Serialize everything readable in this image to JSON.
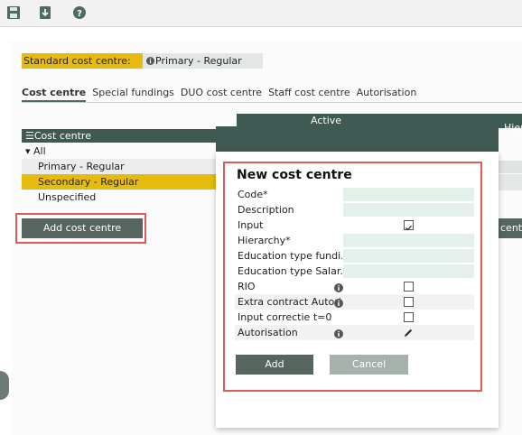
{
  "toolbar": {
    "icons": [
      "save-icon",
      "download-icon",
      "help-icon"
    ]
  },
  "standard": {
    "label": "Standard cost centre:",
    "value": "Primary - Regular"
  },
  "tabs": [
    {
      "label": "Cost centre",
      "active": true
    },
    {
      "label": "Special fundings",
      "active": false
    },
    {
      "label": "DUO cost centre",
      "active": false
    },
    {
      "label": "Staff cost centre",
      "active": false
    },
    {
      "label": "Autorisation",
      "active": false
    }
  ],
  "background_table": {
    "active_header": "Active",
    "hier_header": "Hier"
  },
  "tree": {
    "header": "Cost centre",
    "items": [
      {
        "label": "All"
      },
      {
        "label": "Primary - Regular"
      },
      {
        "label": "Secondary - Regular"
      },
      {
        "label": "Unspecified"
      }
    ]
  },
  "add_cost_centre_button": "Add cost centre",
  "right_button_fragment": "cent",
  "modal": {
    "title": "New cost centre",
    "fields": [
      {
        "label": "Code*"
      },
      {
        "label": "Description"
      },
      {
        "label": "Input",
        "checked": true
      },
      {
        "label": "Hierarchy*"
      },
      {
        "label": "Education type fundi..."
      },
      {
        "label": "Education type Salar..."
      },
      {
        "label": "RIO",
        "checked": false
      },
      {
        "label": "Extra contract Autori",
        "checked": false
      },
      {
        "label": "Input correctie t=0",
        "checked": false
      },
      {
        "label": "Autorisation"
      }
    ],
    "add_button": "Add",
    "cancel_button": "Cancel"
  },
  "colors": {
    "accent_dark": "#3f5a52",
    "button": "#56665f",
    "highlight_yellow": "#e6bb0e",
    "annotation_red": "#e05a5a"
  }
}
